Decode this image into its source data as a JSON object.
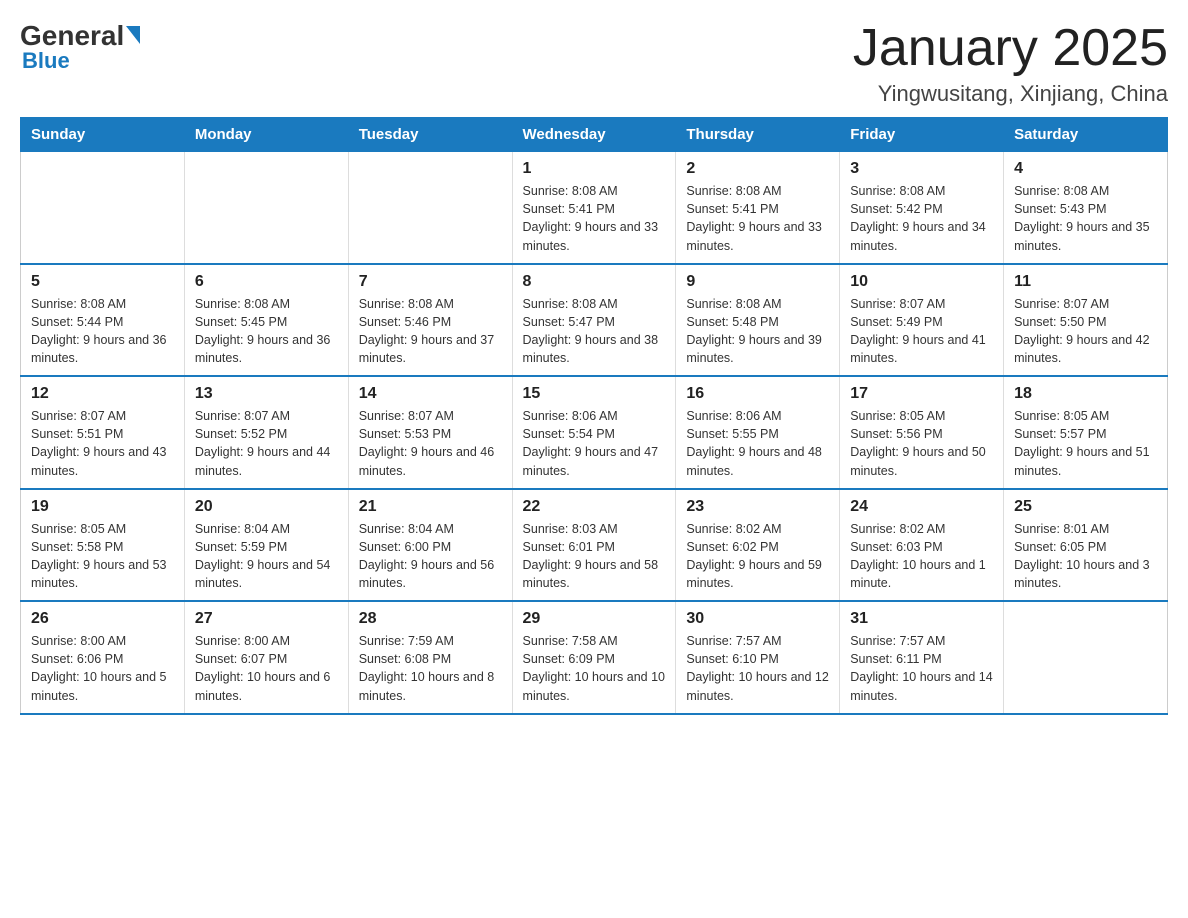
{
  "logo": {
    "general": "General",
    "blue": "Blue"
  },
  "title": "January 2025",
  "subtitle": "Yingwusitang, Xinjiang, China",
  "days_of_week": [
    "Sunday",
    "Monday",
    "Tuesday",
    "Wednesday",
    "Thursday",
    "Friday",
    "Saturday"
  ],
  "weeks": [
    [
      {
        "day": "",
        "info": ""
      },
      {
        "day": "",
        "info": ""
      },
      {
        "day": "",
        "info": ""
      },
      {
        "day": "1",
        "info": "Sunrise: 8:08 AM\nSunset: 5:41 PM\nDaylight: 9 hours and 33 minutes."
      },
      {
        "day": "2",
        "info": "Sunrise: 8:08 AM\nSunset: 5:41 PM\nDaylight: 9 hours and 33 minutes."
      },
      {
        "day": "3",
        "info": "Sunrise: 8:08 AM\nSunset: 5:42 PM\nDaylight: 9 hours and 34 minutes."
      },
      {
        "day": "4",
        "info": "Sunrise: 8:08 AM\nSunset: 5:43 PM\nDaylight: 9 hours and 35 minutes."
      }
    ],
    [
      {
        "day": "5",
        "info": "Sunrise: 8:08 AM\nSunset: 5:44 PM\nDaylight: 9 hours and 36 minutes."
      },
      {
        "day": "6",
        "info": "Sunrise: 8:08 AM\nSunset: 5:45 PM\nDaylight: 9 hours and 36 minutes."
      },
      {
        "day": "7",
        "info": "Sunrise: 8:08 AM\nSunset: 5:46 PM\nDaylight: 9 hours and 37 minutes."
      },
      {
        "day": "8",
        "info": "Sunrise: 8:08 AM\nSunset: 5:47 PM\nDaylight: 9 hours and 38 minutes."
      },
      {
        "day": "9",
        "info": "Sunrise: 8:08 AM\nSunset: 5:48 PM\nDaylight: 9 hours and 39 minutes."
      },
      {
        "day": "10",
        "info": "Sunrise: 8:07 AM\nSunset: 5:49 PM\nDaylight: 9 hours and 41 minutes."
      },
      {
        "day": "11",
        "info": "Sunrise: 8:07 AM\nSunset: 5:50 PM\nDaylight: 9 hours and 42 minutes."
      }
    ],
    [
      {
        "day": "12",
        "info": "Sunrise: 8:07 AM\nSunset: 5:51 PM\nDaylight: 9 hours and 43 minutes."
      },
      {
        "day": "13",
        "info": "Sunrise: 8:07 AM\nSunset: 5:52 PM\nDaylight: 9 hours and 44 minutes."
      },
      {
        "day": "14",
        "info": "Sunrise: 8:07 AM\nSunset: 5:53 PM\nDaylight: 9 hours and 46 minutes."
      },
      {
        "day": "15",
        "info": "Sunrise: 8:06 AM\nSunset: 5:54 PM\nDaylight: 9 hours and 47 minutes."
      },
      {
        "day": "16",
        "info": "Sunrise: 8:06 AM\nSunset: 5:55 PM\nDaylight: 9 hours and 48 minutes."
      },
      {
        "day": "17",
        "info": "Sunrise: 8:05 AM\nSunset: 5:56 PM\nDaylight: 9 hours and 50 minutes."
      },
      {
        "day": "18",
        "info": "Sunrise: 8:05 AM\nSunset: 5:57 PM\nDaylight: 9 hours and 51 minutes."
      }
    ],
    [
      {
        "day": "19",
        "info": "Sunrise: 8:05 AM\nSunset: 5:58 PM\nDaylight: 9 hours and 53 minutes."
      },
      {
        "day": "20",
        "info": "Sunrise: 8:04 AM\nSunset: 5:59 PM\nDaylight: 9 hours and 54 minutes."
      },
      {
        "day": "21",
        "info": "Sunrise: 8:04 AM\nSunset: 6:00 PM\nDaylight: 9 hours and 56 minutes."
      },
      {
        "day": "22",
        "info": "Sunrise: 8:03 AM\nSunset: 6:01 PM\nDaylight: 9 hours and 58 minutes."
      },
      {
        "day": "23",
        "info": "Sunrise: 8:02 AM\nSunset: 6:02 PM\nDaylight: 9 hours and 59 minutes."
      },
      {
        "day": "24",
        "info": "Sunrise: 8:02 AM\nSunset: 6:03 PM\nDaylight: 10 hours and 1 minute."
      },
      {
        "day": "25",
        "info": "Sunrise: 8:01 AM\nSunset: 6:05 PM\nDaylight: 10 hours and 3 minutes."
      }
    ],
    [
      {
        "day": "26",
        "info": "Sunrise: 8:00 AM\nSunset: 6:06 PM\nDaylight: 10 hours and 5 minutes."
      },
      {
        "day": "27",
        "info": "Sunrise: 8:00 AM\nSunset: 6:07 PM\nDaylight: 10 hours and 6 minutes."
      },
      {
        "day": "28",
        "info": "Sunrise: 7:59 AM\nSunset: 6:08 PM\nDaylight: 10 hours and 8 minutes."
      },
      {
        "day": "29",
        "info": "Sunrise: 7:58 AM\nSunset: 6:09 PM\nDaylight: 10 hours and 10 minutes."
      },
      {
        "day": "30",
        "info": "Sunrise: 7:57 AM\nSunset: 6:10 PM\nDaylight: 10 hours and 12 minutes."
      },
      {
        "day": "31",
        "info": "Sunrise: 7:57 AM\nSunset: 6:11 PM\nDaylight: 10 hours and 14 minutes."
      },
      {
        "day": "",
        "info": ""
      }
    ]
  ]
}
